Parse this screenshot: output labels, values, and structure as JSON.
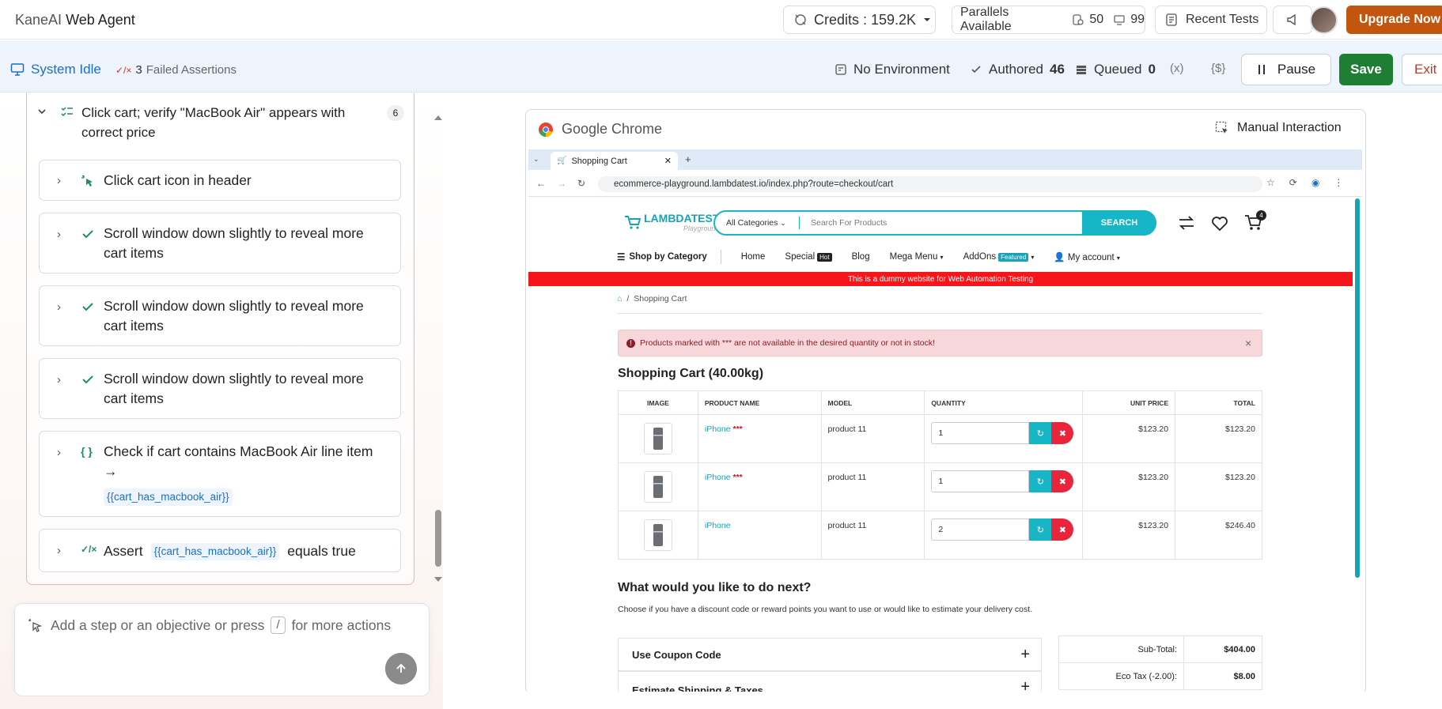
{
  "app": {
    "brand_prefix": "KaneAI",
    "brand_name": "Web Agent"
  },
  "topbar": {
    "credits": "Credits : 159.2K",
    "parallels_label": "Parallels Available",
    "parallels_a": "50",
    "parallels_b": "99",
    "recent_tests": "Recent Tests",
    "upgrade": "Upgrade Now"
  },
  "status": {
    "system": "System Idle",
    "failed_count": "3",
    "failed_label": "Failed Assertions",
    "environment": "No Environment",
    "authored_label": "Authored",
    "authored_count": "46",
    "queued_label": "Queued",
    "queued_count": "0",
    "var_icon": "(x)",
    "secret_icon": "{$}",
    "pause": "Pause",
    "save": "Save",
    "exit": "Exit"
  },
  "steps": {
    "group_title": "Click cart; verify \"MacBook Air\" appears with correct price",
    "group_count": "6",
    "items": [
      {
        "icon": "pointer-click-icon",
        "text": "Click cart icon in header"
      },
      {
        "icon": "check-icon",
        "text": "Scroll window down slightly to reveal more cart items"
      },
      {
        "icon": "check-icon",
        "text": "Scroll window down slightly to reveal more cart items"
      },
      {
        "icon": "check-icon",
        "text": "Scroll window down slightly to reveal more cart items"
      },
      {
        "icon": "code-braces-icon",
        "text": "Check if cart contains MacBook Air line item →",
        "var": "{{cart_has_macbook_air}}"
      },
      {
        "icon": "assert-icon",
        "prefix": "Assert",
        "var": "{{cart_has_macbook_air}}",
        "suffix": "equals true"
      }
    ]
  },
  "composer": {
    "placeholder_a": "Add a step or an objective or press",
    "slash": "/",
    "placeholder_b": "for more actions"
  },
  "browser": {
    "app_label": "Google Chrome",
    "manual": "Manual Interaction",
    "tab_title": "Shopping Cart",
    "url": "ecommerce-playground.lambdatest.io/index.php?route=checkout/cart"
  },
  "site": {
    "logo": "LAMBDATEST",
    "logo_sub": "Playground",
    "category": "All Categories",
    "search_placeholder": "Search For Products",
    "search_btn": "SEARCH",
    "cart_count": "4",
    "nav": {
      "shop": "Shop by Category",
      "home": "Home",
      "special": "Special",
      "hot": "Hot",
      "blog": "Blog",
      "mega": "Mega Menu",
      "addons": "AddOns",
      "featured": "Featured",
      "account": "My account"
    },
    "banner": "This is a dummy website for Web Automation Testing",
    "breadcrumb": "Shopping Cart",
    "alert": "Products marked with *** are not available in the desired quantity or not in stock!",
    "cart_title": "Shopping Cart  (40.00kg)",
    "columns": {
      "image": "IMAGE",
      "name": "PRODUCT NAME",
      "model": "MODEL",
      "qty": "QUANTITY",
      "unit": "UNIT PRICE",
      "total": "TOTAL"
    },
    "rows": [
      {
        "name": "iPhone",
        "stars": "***",
        "model": "product 11",
        "qty": "1",
        "unit": "$123.20",
        "total": "$123.20"
      },
      {
        "name": "iPhone",
        "stars": "***",
        "model": "product 11",
        "qty": "1",
        "unit": "$123.20",
        "total": "$123.20"
      },
      {
        "name": "iPhone",
        "stars": "",
        "model": "product 11",
        "qty": "2",
        "unit": "$123.20",
        "total": "$246.40"
      }
    ],
    "next_title": "What would you like to do next?",
    "next_desc": "Choose if you have a discount code or reward points you want to use or would like to estimate your delivery cost.",
    "coupon": "Use Coupon Code",
    "shipping": "Estimate Shipping & Taxes",
    "subtotal_label": "Sub-Total:",
    "subtotal": "$404.00",
    "ecotax_label": "Eco Tax (-2.00):",
    "ecotax": "$8.00"
  },
  "colors": {
    "accent": "#1a6fc5",
    "save": "#1e7e34",
    "upgrade": "#c2560f",
    "site_teal": "#17b6c6",
    "banner_red": "#f5151a"
  }
}
